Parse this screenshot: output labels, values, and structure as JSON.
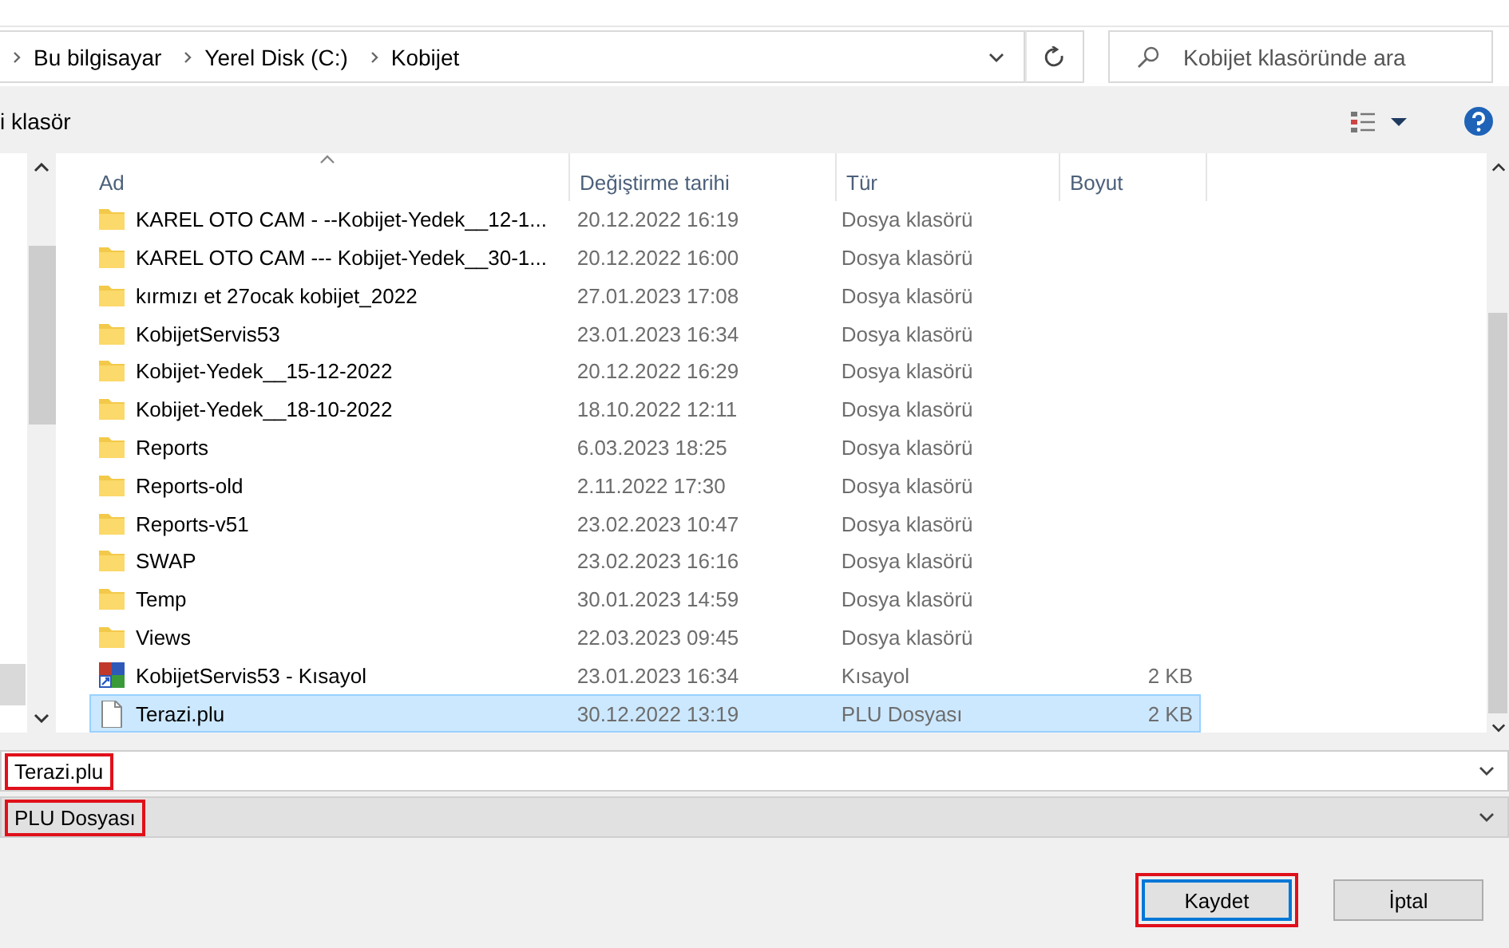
{
  "address_bar": {
    "path": [
      "Bu bilgisayar",
      "Yerel Disk (C:)",
      "Kobijet"
    ]
  },
  "search": {
    "placeholder": "Kobijet klasöründe ara"
  },
  "toolbar": {
    "new_folder": "i klasör"
  },
  "table": {
    "columns": [
      "Ad",
      "Değiştirme tarihi",
      "Tür",
      "Boyut"
    ],
    "rows": [
      {
        "kind": "folder",
        "name": "KAREL OTO CAM - --Kobijet-Yedek__12-1...",
        "date": "20.12.2022 16:19",
        "type": "Dosya klasörü",
        "selected": false
      },
      {
        "kind": "folder",
        "name": "KAREL OTO CAM --- Kobijet-Yedek__30-1...",
        "date": "20.12.2022 16:00",
        "type": "Dosya klasörü",
        "selected": false
      },
      {
        "kind": "folder",
        "name": "kırmızı et 27ocak kobijet_2022",
        "date": "27.01.2023 17:08",
        "type": "Dosya klasörü",
        "selected": false
      },
      {
        "kind": "folder",
        "name": "KobijetServis53",
        "date": "23.01.2023 16:34",
        "type": "Dosya klasörü",
        "selected": false
      },
      {
        "kind": "folder",
        "name": "Kobijet-Yedek__15-12-2022",
        "date": "20.12.2022 16:29",
        "type": "Dosya klasörü",
        "selected": false
      },
      {
        "kind": "folder",
        "name": "Kobijet-Yedek__18-10-2022",
        "date": "18.10.2022 12:11",
        "type": "Dosya klasörü",
        "selected": false
      },
      {
        "kind": "folder",
        "name": "Reports",
        "date": "6.03.2023 18:25",
        "type": "Dosya klasörü",
        "selected": false
      },
      {
        "kind": "folder",
        "name": "Reports-old",
        "date": "2.11.2022 17:30",
        "type": "Dosya klasörü",
        "selected": false
      },
      {
        "kind": "folder",
        "name": "Reports-v51",
        "date": "23.02.2023 10:47",
        "type": "Dosya klasörü",
        "selected": false
      },
      {
        "kind": "folder",
        "name": "SWAP",
        "date": "23.02.2023 16:16",
        "type": "Dosya klasörü",
        "selected": false
      },
      {
        "kind": "folder",
        "name": "Temp",
        "date": "30.01.2023 14:59",
        "type": "Dosya klasörü",
        "selected": false
      },
      {
        "kind": "folder",
        "name": "Views",
        "date": "22.03.2023 09:45",
        "type": "Dosya klasörü",
        "selected": false
      },
      {
        "kind": "shortcut",
        "name": "KobijetServis53 - Kısayol",
        "date": "23.01.2023 16:34",
        "type": "Kısayol",
        "size": "2 KB",
        "selected": false
      },
      {
        "kind": "file",
        "name": "Terazi.plu",
        "date": "30.12.2022 13:19",
        "type": "PLU Dosyası",
        "size": "2 KB",
        "selected": true
      }
    ]
  },
  "file_name": {
    "value": "Terazi.plu",
    "highlighted": true
  },
  "file_type": {
    "value": "PLU Dosyası",
    "highlighted": true
  },
  "buttons": [
    {
      "label": "Kaydet",
      "highlighted": true
    },
    {
      "label": "İptal",
      "highlighted": false
    }
  ]
}
